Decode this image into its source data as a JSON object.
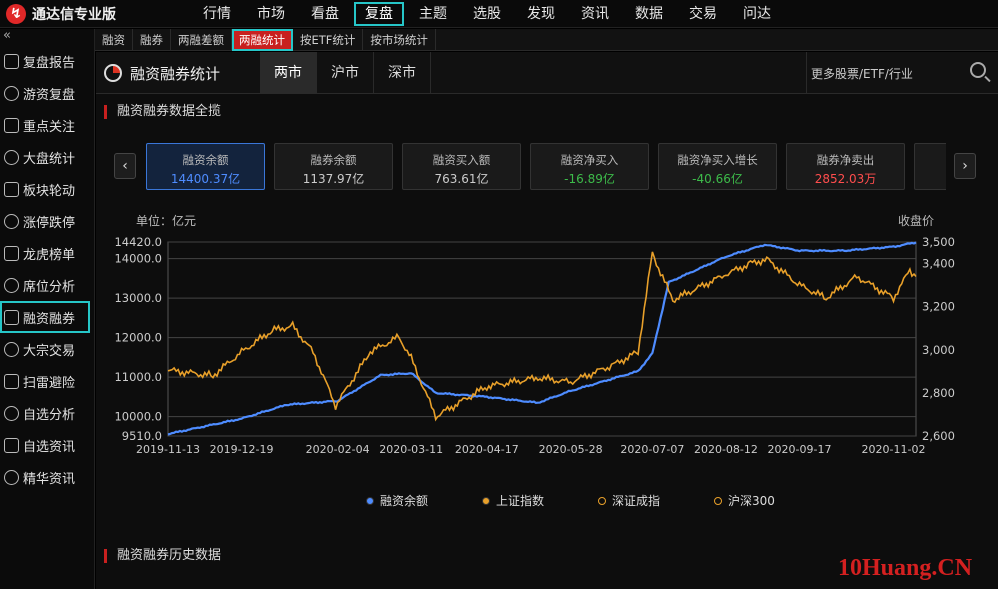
{
  "app": {
    "title": "通达信专业版"
  },
  "menu": [
    "行情",
    "市场",
    "看盘",
    "复盘",
    "主题",
    "选股",
    "发现",
    "资讯",
    "数据",
    "交易",
    "问达"
  ],
  "menu_active": 3,
  "subtabs": [
    "融资",
    "融券",
    "两融差额",
    "两融统计",
    "按ETF统计",
    "按市场统计"
  ],
  "subtab_active": 3,
  "sidebar": {
    "collapse_glyph": "«",
    "items": [
      "复盘报告",
      "游资复盘",
      "重点关注",
      "大盘统计",
      "板块轮动",
      "涨停跌停",
      "龙虎榜单",
      "席位分析",
      "融资融券",
      "大宗交易",
      "扫雷避险",
      "自选分析",
      "自选资讯",
      "精华资讯"
    ],
    "active": 8
  },
  "header": {
    "title": "融资融券统计",
    "tabs": [
      "两市",
      "沪市",
      "深市"
    ],
    "tab_active": 0,
    "search_placeholder": "更多股票/ETF/行业"
  },
  "section1": {
    "title": "融资融券数据全揽"
  },
  "section2": {
    "title": "融资融券历史数据"
  },
  "nav": {
    "prev": "‹",
    "next": "›"
  },
  "cards": [
    {
      "label": "融资余额",
      "value": "14400.37亿",
      "color": "#4e8cff"
    },
    {
      "label": "融券余额",
      "value": "1137.97亿",
      "color": "#cccccc"
    },
    {
      "label": "融资买入额",
      "value": "763.61亿",
      "color": "#cccccc"
    },
    {
      "label": "融资净买入",
      "value": "-16.89亿",
      "color": "#3dbb4a"
    },
    {
      "label": "融资净买入增长",
      "value": "-40.66亿",
      "color": "#3dbb4a"
    },
    {
      "label": "融券净卖出",
      "value": "2852.03万",
      "color": "#ff4d4d"
    },
    {
      "label": "融",
      "value": "",
      "color": "#cccccc"
    }
  ],
  "cards_active": 0,
  "watermark": "10Huang.CN",
  "chart_data": {
    "type": "line",
    "left_unit": "单位：亿元",
    "right_unit": "收盘价",
    "y_left_ticks": [
      "14420.0",
      "14000.0",
      "13000.0",
      "12000.0",
      "11000.0",
      "10000.0",
      "9510.0"
    ],
    "y_left_values": [
      14420,
      14000,
      13000,
      12000,
      11000,
      10000,
      9510
    ],
    "ylim_left": [
      9510,
      14420
    ],
    "y_right_ticks": [
      "3,500",
      "3,400",
      "3,200",
      "3,000",
      "2,800",
      "2,600"
    ],
    "y_right_values": [
      3500,
      3400,
      3200,
      3000,
      2800,
      2600
    ],
    "ylim_right": [
      2600,
      3500
    ],
    "x_ticks": [
      "2019-11-13",
      "2019-12-19",
      "2020-02-04",
      "2020-03-11",
      "2020-04-17",
      "2020-05-28",
      "2020-07-07",
      "2020-08-12",
      "2020-09-17",
      "2020-11-02"
    ],
    "series": [
      {
        "name": "融资余额",
        "axis": "left",
        "color": "#4e8cff",
        "x": [
          "2019-11-13",
          "2019-12-19",
          "2020-01-10",
          "2020-02-04",
          "2020-02-25",
          "2020-03-11",
          "2020-03-23",
          "2020-04-17",
          "2020-05-12",
          "2020-05-28",
          "2020-06-30",
          "2020-07-07",
          "2020-07-15",
          "2020-08-12",
          "2020-08-31",
          "2020-09-17",
          "2020-10-09",
          "2020-11-02",
          "2020-11-13"
        ],
        "values": [
          9560,
          9950,
          10300,
          10400,
          11050,
          11100,
          10600,
          10500,
          10350,
          10650,
          11150,
          11600,
          13400,
          14050,
          14350,
          14200,
          14200,
          14300,
          14410
        ]
      },
      {
        "name": "上证指数",
        "axis": "right",
        "color": "#e8a02a",
        "x": [
          "2019-11-13",
          "2019-12-05",
          "2019-12-19",
          "2020-01-03",
          "2020-01-13",
          "2020-01-23",
          "2020-02-03",
          "2020-02-20",
          "2020-03-05",
          "2020-03-11",
          "2020-03-23",
          "2020-04-17",
          "2020-05-12",
          "2020-05-28",
          "2020-06-18",
          "2020-06-30",
          "2020-07-07",
          "2020-07-10",
          "2020-07-17",
          "2020-08-12",
          "2020-08-24",
          "2020-09-01",
          "2020-09-17",
          "2020-09-30",
          "2020-10-15",
          "2020-11-02",
          "2020-11-10",
          "2020-11-13"
        ],
        "values": [
          2905,
          2880,
          2990,
          3090,
          3110,
          2990,
          2740,
          2990,
          3060,
          2960,
          2690,
          2830,
          2870,
          2850,
          2930,
          2990,
          3450,
          3380,
          3230,
          3350,
          3400,
          3420,
          3300,
          3240,
          3340,
          3240,
          3370,
          3340
        ]
      }
    ],
    "legend": [
      "融资余额",
      "上证指数",
      "深证成指",
      "沪深300"
    ],
    "legend_colors": [
      "#4e8cff",
      "#e8a02a",
      "#e8a02a",
      "#e8a02a"
    ],
    "legend_filled": [
      true,
      true,
      false,
      false
    ],
    "legend_position": "bottom"
  }
}
